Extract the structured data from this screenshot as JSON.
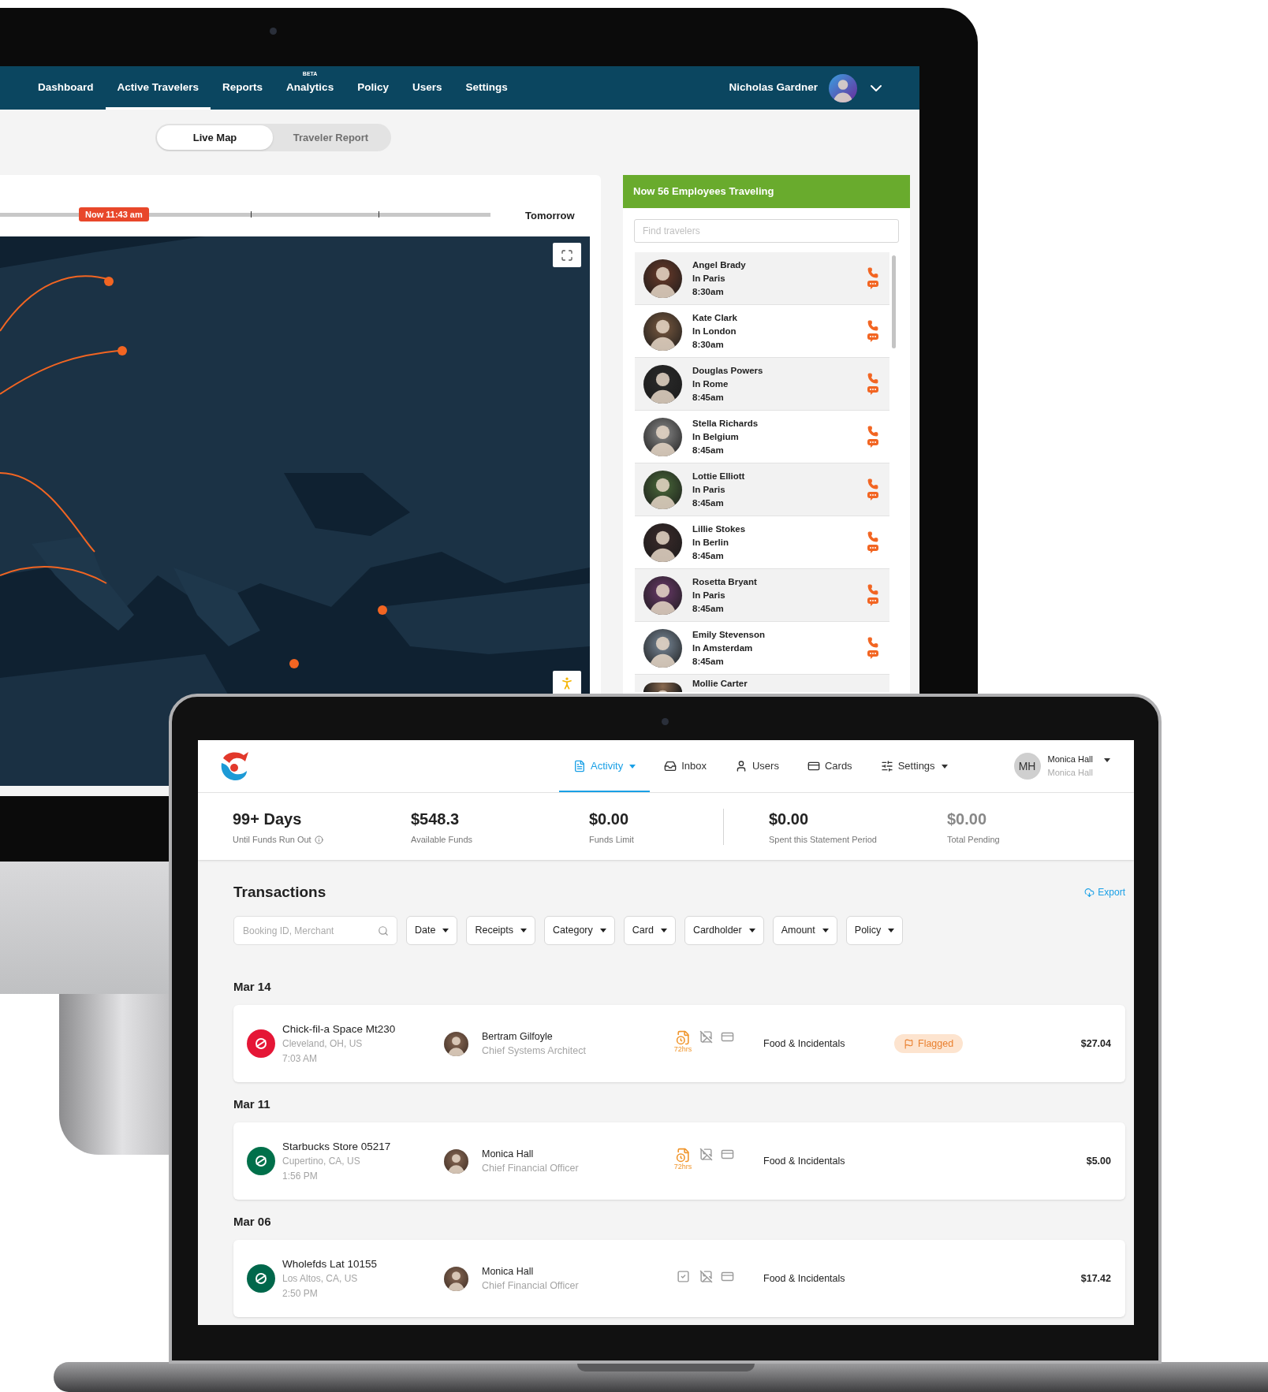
{
  "desktop": {
    "nav": {
      "items": [
        {
          "label": "Dashboard",
          "selected": false
        },
        {
          "label": "Active Travelers",
          "selected": true
        },
        {
          "label": "Reports",
          "selected": false
        },
        {
          "label": "Analytics",
          "selected": false,
          "badge": "BETA"
        },
        {
          "label": "Policy",
          "selected": false
        },
        {
          "label": "Users",
          "selected": false
        },
        {
          "label": "Settings",
          "selected": false
        }
      ],
      "user": {
        "name": "Nicholas Gardner"
      }
    },
    "view_toggle": [
      {
        "label": "Live Map",
        "selected": true
      },
      {
        "label": "Traveler Report",
        "selected": false
      }
    ],
    "timeline": {
      "now_label": "Now 11:43 am",
      "end_label": "Tomorrow"
    },
    "travelers_panel": {
      "title": "Now 56 Employees Traveling",
      "search": {
        "placeholder": "Find travelers"
      },
      "travelers": [
        {
          "name": "Angel Brady",
          "location": "In Paris",
          "time": "8:30am"
        },
        {
          "name": "Kate Clark",
          "location": "In London",
          "time": "8:30am"
        },
        {
          "name": "Douglas Powers",
          "location": "In Rome",
          "time": "8:45am"
        },
        {
          "name": "Stella Richards",
          "location": "In Belgium",
          "time": "8:45am"
        },
        {
          "name": "Lottie Elliott",
          "location": "In Paris",
          "time": "8:45am"
        },
        {
          "name": "Lillie Stokes",
          "location": "In Berlin",
          "time": "8:45am"
        },
        {
          "name": "Rosetta Bryant",
          "location": "In Paris",
          "time": "8:45am"
        },
        {
          "name": "Emily Stevenson",
          "location": "In Amsterdam",
          "time": "8:45am"
        },
        {
          "name": "Mollie Carter"
        }
      ]
    }
  },
  "laptop": {
    "nav": {
      "tabs": [
        {
          "label": "Activity",
          "kind": "document",
          "selected": true,
          "dropdown": true
        },
        {
          "label": "Inbox",
          "kind": "tray",
          "selected": false,
          "dropdown": false
        },
        {
          "label": "Users",
          "kind": "person",
          "selected": false,
          "dropdown": false
        },
        {
          "label": "Cards",
          "kind": "card",
          "selected": false,
          "dropdown": false
        },
        {
          "label": "Settings",
          "kind": "sliders",
          "selected": false,
          "dropdown": true
        }
      ],
      "user": {
        "initials": "MH",
        "name": "Monica Hall",
        "subtitle": "Monica Hall"
      }
    },
    "stat_groups": [
      {
        "stats": [
          {
            "value": "99+ Days",
            "label": "Until Funds Run Out",
            "info": true,
            "muted": false
          },
          {
            "value": "$548.3",
            "label": "Available Funds",
            "info": false,
            "muted": false
          },
          {
            "value": "$0.00",
            "label": "Funds Limit",
            "info": false,
            "muted": false
          }
        ]
      },
      {
        "stats": [
          {
            "value": "$0.00",
            "label": "Spent this Statement Period",
            "info": false,
            "muted": false
          },
          {
            "value": "$0.00",
            "label": "Total Pending",
            "info": false,
            "muted": true
          }
        ]
      }
    ],
    "transactions": {
      "title": "Transactions",
      "export": "Export",
      "search": {
        "placeholder": "Booking ID, Merchant"
      },
      "filters": [
        "Date",
        "Receipts",
        "Category",
        "Card",
        "Cardholder",
        "Amount",
        "Policy"
      ],
      "groups": [
        {
          "date": "Mar 14",
          "items": [
            {
              "merchant": "Chick-fil-a Space Mt230",
              "location": "Cleveland, OH, US",
              "time": "7:03 AM",
              "color": "#e51636",
              "person": "Bertram Gilfoyle",
              "role": "Chief Systems Architect",
              "receipt": {
                "kind": "pending",
                "label": "72hrs"
              },
              "category": "Food & Incidentals",
              "flagged": true,
              "flag_label": "Flagged",
              "amount": "$27.04"
            }
          ]
        },
        {
          "date": "Mar 11",
          "items": [
            {
              "merchant": "Starbucks Store 05217",
              "location": "Cupertino, CA, US",
              "time": "1:56 PM",
              "color": "#00704a",
              "person": "Monica Hall",
              "role": "Chief Financial Officer",
              "receipt": {
                "kind": "pending",
                "label": "72hrs"
              },
              "category": "Food & Incidentals",
              "flagged": false,
              "amount": "$5.00"
            }
          ]
        },
        {
          "date": "Mar 06",
          "items": [
            {
              "merchant": "Wholefds Lat 10155",
              "location": "Los Altos, CA, US",
              "time": "2:50 PM",
              "color": "#00674b",
              "person": "Monica Hall",
              "role": "Chief Financial Officer",
              "receipt": {
                "kind": "attached"
              },
              "category": "Food & Incidentals",
              "flagged": false,
              "amount": "$17.42"
            }
          ]
        }
      ]
    }
  }
}
